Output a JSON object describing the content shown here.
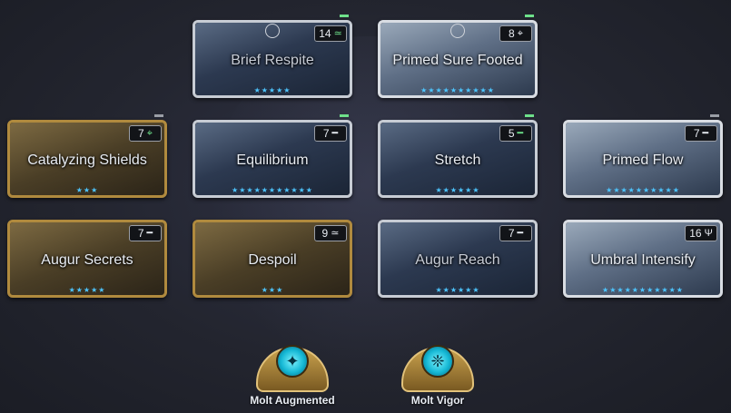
{
  "mods": [
    {
      "name": "Brief Respite",
      "cost": "14",
      "polarity": "≃",
      "rank": "★★★★★",
      "style": "silver",
      "dim": true
    },
    {
      "name": "Primed Sure Footed",
      "cost": "8",
      "polarity": "⌖",
      "rank": "★★★★★★★★★★",
      "style": "primed",
      "dim": false
    },
    {
      "name": "Catalyzing Shields",
      "cost": "7",
      "polarity": "⌖",
      "rank": "★★★",
      "style": "gold",
      "dim": false
    },
    {
      "name": "Equilibrium",
      "cost": "7",
      "polarity": "━",
      "rank": "★★★★★★★★★★★",
      "style": "silver",
      "dim": false
    },
    {
      "name": "Stretch",
      "cost": "5",
      "polarity": "━",
      "rank": "★★★★★★",
      "style": "silver",
      "dim": false
    },
    {
      "name": "Primed Flow",
      "cost": "7",
      "polarity": "━",
      "rank": "★★★★★★★★★★",
      "style": "primed",
      "dim": false
    },
    {
      "name": "Augur Secrets",
      "cost": "7",
      "polarity": "━",
      "rank": "★★★★★",
      "style": "gold",
      "dim": false
    },
    {
      "name": "Despoil",
      "cost": "9",
      "polarity": "≃",
      "rank": "★★★",
      "style": "gold",
      "dim": false
    },
    {
      "name": "Augur Reach",
      "cost": "7",
      "polarity": "━",
      "rank": "★★★★★★",
      "style": "silver",
      "dim": true
    },
    {
      "name": "Umbral Intensify",
      "cost": "16",
      "polarity": "Ψ",
      "rank": "★★★★★★★★★★★",
      "style": "primed",
      "dim": false
    }
  ],
  "arcanes": [
    {
      "name": "Molt Augmented",
      "glyph": "✦"
    },
    {
      "name": "Molt Vigor",
      "glyph": "❈"
    }
  ],
  "colors": {
    "rank_star": "#4ec6ff",
    "polarity_match": "#6ee08a",
    "gold_frame": "#b08a3e",
    "silver_frame": "#8d9097"
  }
}
